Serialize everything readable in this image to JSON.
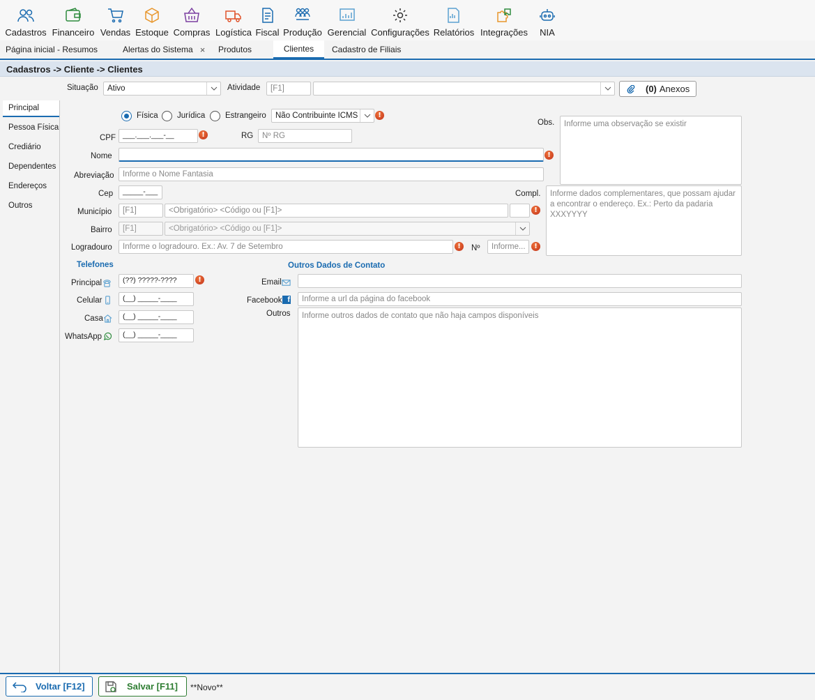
{
  "toolbar": {
    "items": [
      {
        "label": "Cadastros",
        "icon": "users-icon"
      },
      {
        "label": "Financeiro",
        "icon": "wallet-icon"
      },
      {
        "label": "Vendas",
        "icon": "cart-icon"
      },
      {
        "label": "Estoque",
        "icon": "box-icon"
      },
      {
        "label": "Compras",
        "icon": "basket-icon"
      },
      {
        "label": "Logística",
        "icon": "truck-icon"
      },
      {
        "label": "Fiscal",
        "icon": "document-icon"
      },
      {
        "label": "Produção",
        "icon": "team-icon"
      },
      {
        "label": "Gerencial",
        "icon": "chart-icon"
      },
      {
        "label": "Configurações",
        "icon": "gear-icon"
      },
      {
        "label": "Relatórios",
        "icon": "report-icon"
      },
      {
        "label": "Integrações",
        "icon": "puzzle-icon"
      },
      {
        "label": "NIA",
        "icon": "robot-icon"
      }
    ]
  },
  "tabs": [
    {
      "label": "Página inicial - Resumos"
    },
    {
      "label": "Alertas do Sistema",
      "close": "×"
    },
    {
      "label": "Produtos"
    },
    {
      "label": "Clientes"
    },
    {
      "label": "Cadastro de Filiais"
    }
  ],
  "breadcrumb": "Cadastros -> Cliente -> Clientes",
  "header": {
    "situacao_label": "Situação",
    "situacao_value": "Ativo",
    "atividade_label": "Atividade",
    "atividade_code": "[F1]",
    "anexos_count": "(0)",
    "anexos_label": "Anexos"
  },
  "sidenav": [
    "Principal",
    "Pessoa Física",
    "Crediário",
    "Dependentes",
    "Endereços",
    "Outros"
  ],
  "form": {
    "radios": [
      "Física",
      "Jurídica",
      "Estrangeiro"
    ],
    "icms_value": "Não Contribuinte ICMS",
    "err_mark": "!",
    "cpf_label": "CPF",
    "cpf_mask": "___.___.___-__",
    "rg_label": "RG",
    "rg_placeholder": "Nº RG",
    "obs_label": "Obs.",
    "obs_placeholder": "Informe uma observação se existir",
    "nome_label": "Nome",
    "abrev_label": "Abreviação",
    "abrev_placeholder": "Informe o Nome Fantasia",
    "cep_label": "Cep",
    "cep_mask": "_____-___",
    "compl_label": "Compl.",
    "compl_placeholder": "Informe dados complementares, que possam ajudar a encontrar o endereço. Ex.: Perto da padaria XXXYYYY",
    "municipio_label": "Município",
    "municipio_code": "[F1]",
    "municipio_placeholder": "<Obrigatório> <Código ou [F1]>",
    "bairro_label": "Bairro",
    "bairro_code": "[F1]",
    "bairro_placeholder": "<Obrigatório> <Código ou [F1]>",
    "logradouro_label": "Logradouro",
    "logradouro_placeholder": "Informe o logradouro. Ex.: Av. 7 de Setembro",
    "numero_label": "Nº",
    "numero_placeholder": "Informe...",
    "telefones_title": "Telefones",
    "principal_label": "Principal",
    "principal_mask": "(??) ?????-????",
    "celular_label": "Celular",
    "casa_label": "Casa",
    "whatsapp_label": "WhatsApp",
    "phone_mask": "(__) _____-____",
    "outros_title": "Outros Dados de Contato",
    "email_label": "Email",
    "facebook_label": "Facebook",
    "facebook_placeholder": "Informe a url da página do facebook",
    "outros_label": "Outros",
    "outros_placeholder": "Informe outros dados de contato que não haja campos disponíveis"
  },
  "footer": {
    "voltar_label": "Voltar [F12]",
    "salvar_label": "Salvar [F11]",
    "status": "**Novo**"
  },
  "colors": {
    "accent": "#1a6bb0",
    "success": "#2e7d32",
    "error": "#d9461e"
  }
}
